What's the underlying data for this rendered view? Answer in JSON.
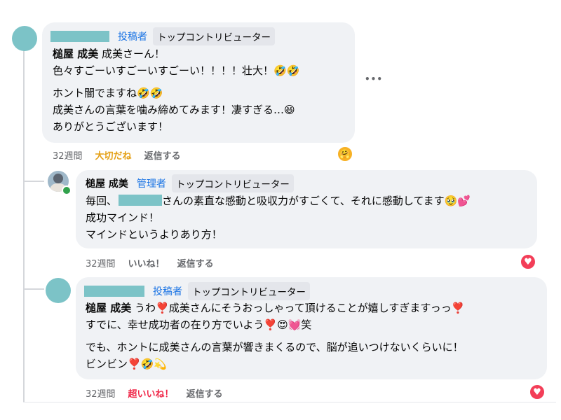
{
  "comments": [
    {
      "role": "投稿者",
      "badge": "トップコントリビューター",
      "mention": "槌屋 成美",
      "lines": [
        "成美さーん！",
        "色々すごーいすごーいすごーい！！！！壮大！🤣🤣",
        "ホント闇でますね🤣🤣",
        "成美さんの言葉を噛み締めてみます！凄すぎる…😆",
        "ありがとうございます！"
      ],
      "time": "32週間",
      "reaction_label": "大切だね",
      "reply_label": "返信する",
      "reaction_icon": "care-emoji-icon",
      "more_label": "•••"
    },
    {
      "name": "槌屋 成美",
      "role": "管理者",
      "badge": "トップコントリビューター",
      "line1_prefix": "毎回、",
      "line1_suffix": "さんの素直な感動と吸収力がすごくて、それに感動してます🥹💕",
      "lines": [
        "成功マインド！",
        "マインドというよりあり方！"
      ],
      "time": "32週間",
      "reaction_label": "いいね！",
      "reply_label": "返信する",
      "reaction_icon": "heart-reaction-icon"
    },
    {
      "role": "投稿者",
      "badge": "トップコントリビューター",
      "mention": "槌屋 成美",
      "lines": [
        "うわ❣️成美さんにそうおっしゃって頂けることが嬉しすぎますっっ❣️",
        "すでに、幸せ成功者の在り方でいよう❣️😍💓笑",
        "でも、ホントに成美さんの言葉が響きまくるので、脳が追いつけないくらいに！",
        "ビンビン❣️🤣💫"
      ],
      "time": "32週間",
      "reaction_label": "超いいね！",
      "reply_label": "返信する",
      "reaction_icon": "heart-reaction-icon"
    }
  ],
  "colors": {
    "bubble": "#f0f2f5",
    "avatar": "#7cc3c7",
    "role_blue": "#1b74e4",
    "love_orange": "#e4a016",
    "super_red": "#f02849",
    "heart": "#f33e58"
  }
}
